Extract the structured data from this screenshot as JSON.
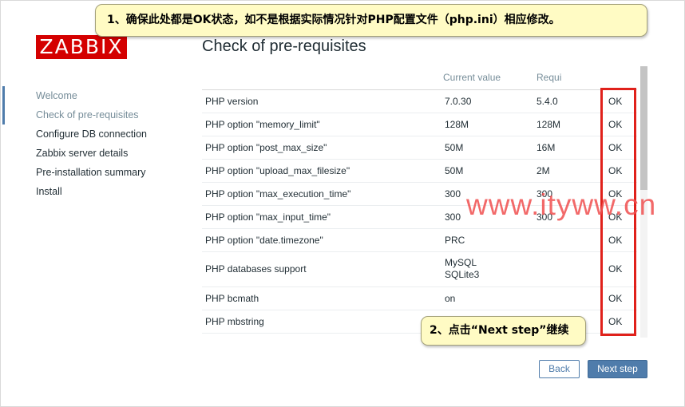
{
  "logo": {
    "text": "ZABBIX"
  },
  "sidebar": {
    "items": [
      {
        "label": "Welcome"
      },
      {
        "label": "Check of pre-requisites"
      },
      {
        "label": "Configure DB connection"
      },
      {
        "label": "Zabbix server details"
      },
      {
        "label": "Pre-installation summary"
      },
      {
        "label": "Install"
      }
    ]
  },
  "main": {
    "title": "Check of pre-requisites",
    "table": {
      "headers": {
        "name": "",
        "current": "Current value",
        "required": "Requi",
        "result": ""
      },
      "rows": [
        {
          "name": "PHP version",
          "current": "7.0.30",
          "required": "5.4.0",
          "result": "OK"
        },
        {
          "name": "PHP option \"memory_limit\"",
          "current": "128M",
          "required": "128M",
          "result": "OK"
        },
        {
          "name": "PHP option \"post_max_size\"",
          "current": "50M",
          "required": "16M",
          "result": "OK"
        },
        {
          "name": "PHP option \"upload_max_filesize\"",
          "current": "50M",
          "required": "2M",
          "result": "OK"
        },
        {
          "name": "PHP option \"max_execution_time\"",
          "current": "300",
          "required": "300",
          "result": "OK"
        },
        {
          "name": "PHP option \"max_input_time\"",
          "current": "300",
          "required": "300",
          "result": "OK"
        },
        {
          "name": "PHP option \"date.timezone\"",
          "current": "PRC",
          "required": "",
          "result": "OK"
        },
        {
          "name": "PHP databases support",
          "current_line1": "MySQL",
          "current_line2": "SQLite3",
          "required": "",
          "result": "OK"
        },
        {
          "name": "PHP bcmath",
          "current": "on",
          "required": "",
          "result": "OK"
        },
        {
          "name": "PHP mbstring",
          "current": "",
          "required": "",
          "result": "OK"
        }
      ]
    }
  },
  "annotations": {
    "callout1": "1、确保此处都是OK状态，如不是根据实际情况针对PHP配置文件（php.ini）相应修改。",
    "callout2": "2、点击“Next step”继续",
    "watermark": "www.ityww.cn"
  },
  "buttons": {
    "back": "Back",
    "next": "Next step"
  },
  "colors": {
    "accent": "#4f7cab",
    "ok": "#59a12a",
    "logo": "#d40000",
    "highlight": "#e0211b",
    "callout_bg": "#fffbc4"
  }
}
